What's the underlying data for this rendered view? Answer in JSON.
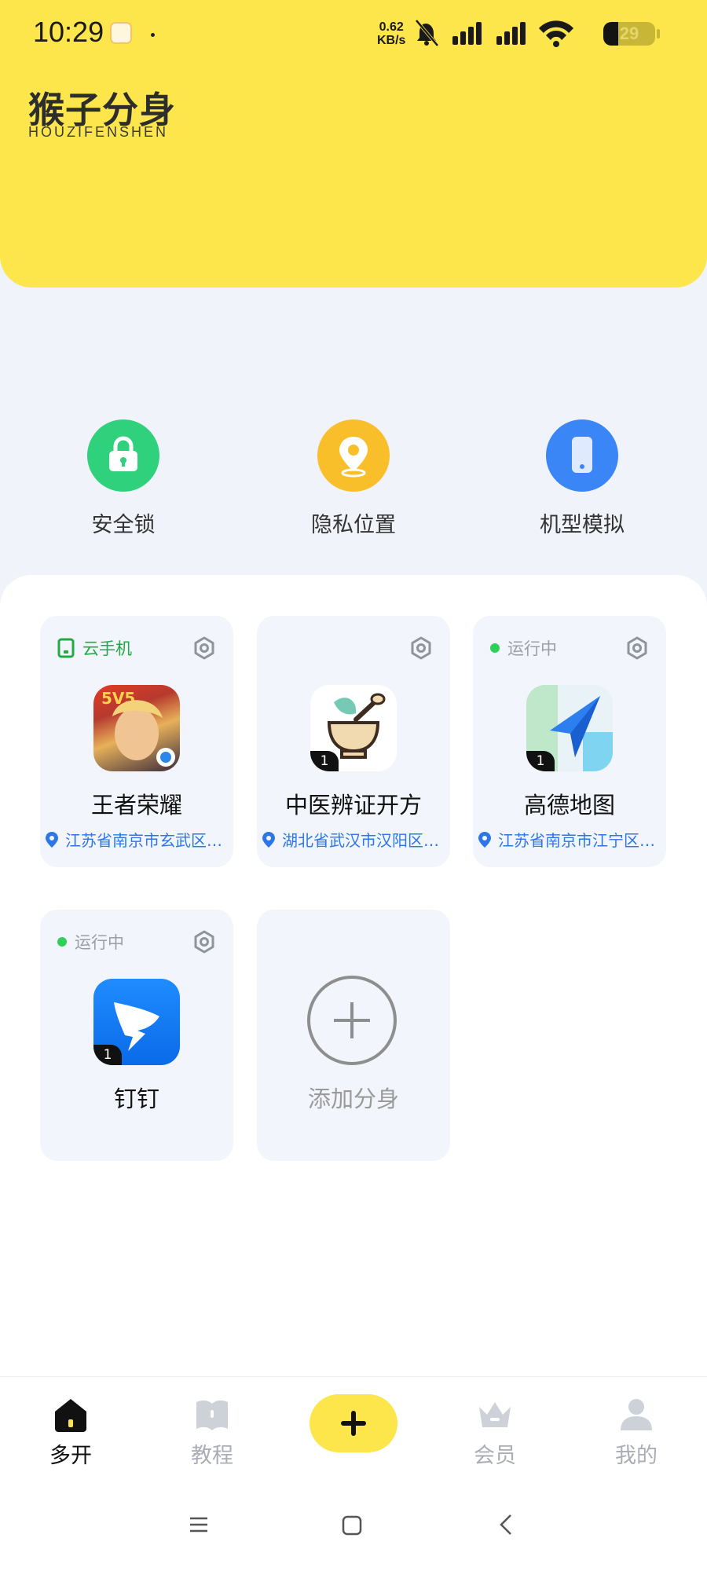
{
  "status_bar": {
    "time": "10:29",
    "net_speed_value": "0.62",
    "net_speed_unit": "KB/s",
    "battery_level": "29",
    "icons": [
      "app-notification-icon",
      "silent-bell-icon",
      "signal-icon",
      "signal-icon",
      "wifi-icon",
      "battery-icon"
    ]
  },
  "brand": {
    "name": "猴子分身",
    "subtitle": "HOUZIFENSHEN",
    "accent_color": "#fce64c"
  },
  "features": [
    {
      "label": "安全锁",
      "icon": "lock-icon",
      "color": "#2fd17d"
    },
    {
      "label": "隐私位置",
      "icon": "location-pin-icon",
      "color": "#f8bf2a"
    },
    {
      "label": "机型模拟",
      "icon": "phone-icon",
      "color": "#3a86f6"
    }
  ],
  "apps": [
    {
      "tag": "云手机",
      "tag_type": "cloud-phone",
      "name": "王者荣耀",
      "location": "江苏省南京市玄武区…",
      "badge": ""
    },
    {
      "tag": "",
      "tag_type": "none",
      "name": "中医辨证开方",
      "location": "湖北省武汉市汉阳区…",
      "badge": "1"
    },
    {
      "tag": "运行中",
      "tag_type": "running",
      "name": "高德地图",
      "location": "江苏省南京市江宁区…",
      "badge": "1"
    },
    {
      "tag": "运行中",
      "tag_type": "running",
      "name": "钉钉",
      "location": "",
      "badge": "1"
    }
  ],
  "add_card": {
    "label": "添加分身"
  },
  "bottom_nav": [
    {
      "label": "多开",
      "icon": "home-icon",
      "active": true
    },
    {
      "label": "教程",
      "icon": "book-icon",
      "active": false
    },
    {
      "label": "",
      "icon": "plus-icon",
      "active": false
    },
    {
      "label": "会员",
      "icon": "crown-icon",
      "active": false
    },
    {
      "label": "我的",
      "icon": "user-icon",
      "active": false
    }
  ],
  "system_nav": [
    "menu-icon",
    "home-square-icon",
    "back-icon"
  ]
}
